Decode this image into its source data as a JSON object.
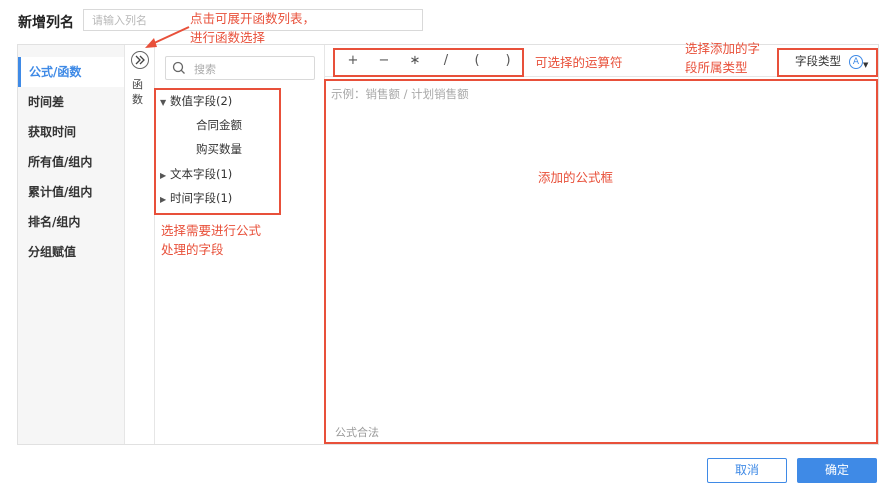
{
  "dialog": {
    "title": "新增列名",
    "name_placeholder": "请输入列名"
  },
  "left_nav": {
    "items": [
      {
        "label": "公式/函数",
        "active": true
      },
      {
        "label": "时间差"
      },
      {
        "label": "获取时间"
      },
      {
        "label": "所有值/组内"
      },
      {
        "label": "累计值/组内"
      },
      {
        "label": "排名/组内"
      },
      {
        "label": "分组赋值"
      }
    ]
  },
  "function_panel": {
    "expand_icon": "double-chevron-right-icon",
    "label": "函数"
  },
  "fields": {
    "search_placeholder": "搜索",
    "groups": [
      {
        "label": "数值字段(2)",
        "expanded": true,
        "children": [
          "合同金额",
          "购买数量"
        ]
      },
      {
        "label": "文本字段(1)",
        "expanded": false
      },
      {
        "label": "时间字段(1)",
        "expanded": false
      }
    ]
  },
  "operators": [
    "+",
    "−",
    "∗",
    "/",
    "(",
    ")"
  ],
  "field_type": {
    "label": "字段类型",
    "icon": "A"
  },
  "formula": {
    "placeholder": "示例：销售额 / 计划销售额",
    "status": "公式合法"
  },
  "annotations": {
    "expand_note_1": "点击可展开函数列表，",
    "expand_note_2": "进行函数选择",
    "operators_note": "可选择的运算符",
    "field_type_note_1": "选择添加的字",
    "field_type_note_2": "段所属类型",
    "formula_note": "添加的公式框",
    "fields_note_1": "选择需要进行公式",
    "fields_note_2": "处理的字段"
  },
  "buttons": {
    "cancel": "取消",
    "ok": "确定"
  },
  "colors": {
    "accent": "#3f8ae6",
    "annotation": "#e8503a"
  }
}
